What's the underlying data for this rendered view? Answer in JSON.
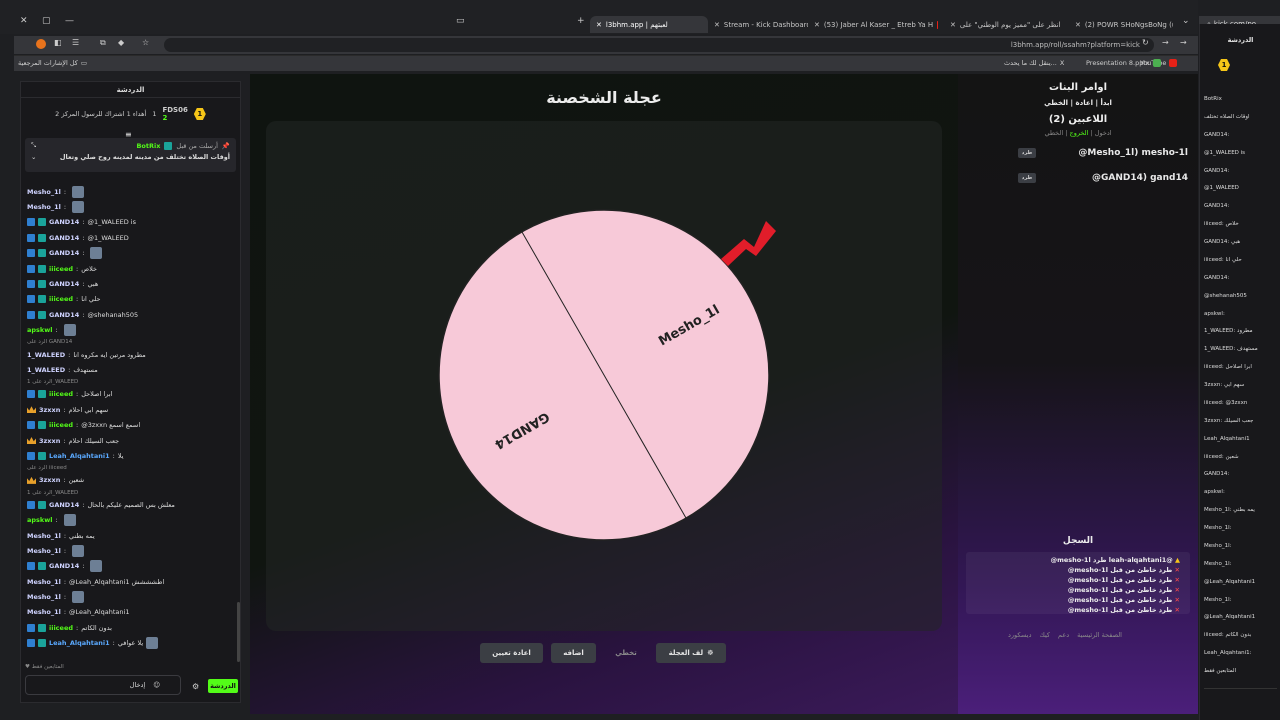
{
  "browser": {
    "tabs": [
      {
        "label": "l3bhm.app | لعبتهم",
        "active": true
      },
      {
        "label": "Stream - Kick Dashboard"
      },
      {
        "label": "(53) Jaber Al Kaser _ Etreb Ya H"
      },
      {
        "label": "انظر على \"مميز يوم الوطني\" على"
      },
      {
        "label": "(2) POWR SHoNgsBoNg (@SH"
      }
    ],
    "tab2": {
      "label": "kick.com/po..."
    },
    "url": "l3bhm.app/roll/ssahm?platform=kick",
    "bookmarks_all": "كل الإشارات المرجعية",
    "bookmarks": [
      "YouTube",
      "Presentation 8.pptx",
      "ينقل لك ما يحدث..."
    ]
  },
  "chat": {
    "header": "الدردشة",
    "gift_user": "FDS06",
    "gift_count": "2",
    "gift_rank": "1",
    "gift_text": "أهداء 1 اشتراك للرسول المركز 2",
    "pinned_by": "أرسلت من قبل",
    "pinned_user": "BotRix",
    "pinned_text": "أوقات الصلاه تختلف من مدينه لمدينه روح صلي وتعال",
    "messages": [
      {
        "user": "Mesho_1l",
        "text": "",
        "emote": true
      },
      {
        "user": "Mesho_1l",
        "text": "",
        "emote": true
      },
      {
        "user": "GAND14",
        "text": "@1_WALEED is",
        "badge": true
      },
      {
        "user": "GAND14",
        "text": "@1_WALEED",
        "badge": true
      },
      {
        "user": "GAND14",
        "text": "",
        "badge": true,
        "emote": true
      },
      {
        "user": "iiiceed",
        "text": "خلاص",
        "badge": true,
        "g": true
      },
      {
        "user": "GAND14",
        "text": "هبي",
        "badge": true
      },
      {
        "user": "iiiceed",
        "text": "حلي انا",
        "badge": true,
        "g": true
      },
      {
        "user": "GAND14",
        "text": "@shehanah505",
        "badge": true
      },
      {
        "user": "apskwl",
        "text": "",
        "emote": true,
        "g": true
      },
      {
        "user": "1_WALEED",
        "text": "مطرود مرتين ايه مكروه انا",
        "reply": "الرد على GAND14"
      },
      {
        "user": "1_WALEED",
        "text": "مستهدف"
      },
      {
        "user": "iiiceed",
        "text": "ابرا اصلاحل",
        "badge": true,
        "g": true,
        "reply": "الرد على 1_WALEED"
      },
      {
        "user": "3zxxn",
        "text": "سهم ابي احلام",
        "crown": true
      },
      {
        "user": "iiiceed",
        "text": "@3zxxn اسمع اسمع",
        "badge": true,
        "g": true
      },
      {
        "user": "3zxxn",
        "text": "جعب السيلك احلام",
        "crown": true
      },
      {
        "user": "Leah_Alqahtani1",
        "text": "يلا",
        "badge": true,
        "b": true
      },
      {
        "user": "3zxxn",
        "text": "شعين",
        "crown": true,
        "reply": "الرد على iiiceed"
      },
      {
        "user": "GAND14",
        "text": "معلش بس الصميم عليكم بالحال",
        "badge": true,
        "reply": "الرد على 1_WALEED"
      },
      {
        "user": "apskwl",
        "text": "",
        "emote": true,
        "g": true
      },
      {
        "user": "Mesho_1l",
        "text": "يمه بطني"
      },
      {
        "user": "Mesho_1l",
        "text": "",
        "emote": true
      },
      {
        "user": "GAND14",
        "text": "",
        "badge": true,
        "emote": true
      },
      {
        "user": "Mesho_1l",
        "text": "@Leah_Alqahtani1 اطشششش"
      },
      {
        "user": "Mesho_1l",
        "text": "",
        "emote": true
      },
      {
        "user": "Mesho_1l",
        "text": "@Leah_Alqahtani1"
      },
      {
        "user": "iiiceed",
        "text": "بدون الكاتم",
        "badge": true,
        "g": true
      },
      {
        "user": "Leah_Alqahtani1",
        "text": "يلا عوافي",
        "badge": true,
        "b": true,
        "emote": true
      }
    ],
    "followers_only": "المتابعين فقط",
    "input_placeholder": "إدخال",
    "send_label": "الدردشة"
  },
  "game": {
    "title": "عجلة الشخصنة",
    "wheel": {
      "color": "#f7c9d8",
      "segments": [
        "Mesho_1l",
        "GAND14"
      ]
    },
    "buttons": {
      "spin": "لف العجلة",
      "skip": "تخطي",
      "add": "اضافه",
      "reset": "اعادة تعيين"
    }
  },
  "panel": {
    "commands_title": "اوامر البنات",
    "commands": "ابدأ | اعادة | الخطي",
    "players_title": "اللاعبين (2)",
    "join_line": [
      "ادخول",
      "الخروج",
      "الخطي"
    ],
    "players": [
      {
        "name": "@Mesho_1l) mesho-1l",
        "kick": "طرد"
      },
      {
        "name": "@GAND14) gand14",
        "kick": "طرد"
      }
    ],
    "log_title": "السجل",
    "log": [
      {
        "text": "@leah-alqahtani1 طرد mesho-1l@",
        "x": false
      },
      {
        "text": "طرد خاطئ من قبل mesho-1l@",
        "x": true
      },
      {
        "text": "طرد خاطئ من قبل mesho-1l@",
        "x": true
      },
      {
        "text": "طرد خاطئ من قبل mesho-1l@",
        "x": true
      },
      {
        "text": "طرد خاطئ من قبل mesho-1l@",
        "x": true
      },
      {
        "text": "طرد خاطئ من قبل mesho-1l@",
        "x": true
      }
    ],
    "footer": [
      "الصفحة الرئيسية",
      "دعم",
      "كيك",
      "ديسكورد"
    ]
  },
  "side_chat": {
    "header": "الدردشة",
    "lines": [
      "BotRix",
      "أوقات الصلاه تختلف",
      "GAND14:",
      "@1_WALEED is",
      "GAND14:",
      "@1_WALEED",
      "GAND14:",
      "iiiceed: خلاص",
      "GAND14: هبي",
      "iiiceed: حلي انا",
      "GAND14:",
      "@shehanah505",
      "apskwl:",
      "1_WALEED: مطرود",
      "1_WALEED: مستهدف",
      "iiiceed: ابرا اصلاحل",
      "3zxxn: سهم ابي",
      "iiiceed: @3zxxn",
      "3zxxn: جعب السيلك",
      "Leah_Alqahtani1",
      "iiiceed: شعين",
      "GAND14:",
      "apskwl:",
      "Mesho_1l: يمه بطني",
      "Mesho_1l:",
      "Mesho_1l:",
      "Mesho_1l:",
      "@Leah_Alqahtani1",
      "Mesho_1l:",
      "@Leah_Alqahtani1",
      "iiiceed: بدون الكاتم",
      "Leah_Alqahtani1:",
      "المتابعين فقط"
    ]
  }
}
